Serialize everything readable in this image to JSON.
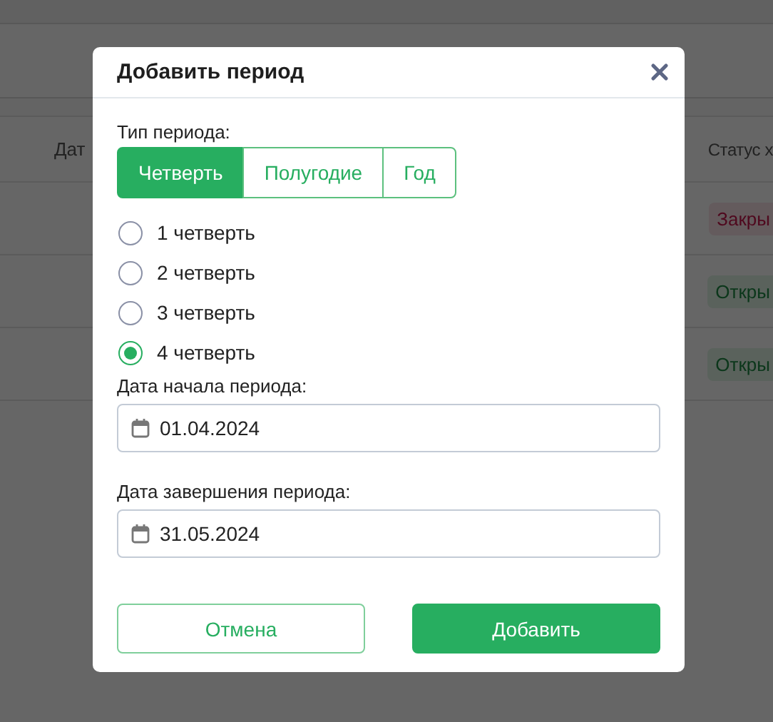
{
  "background": {
    "table": {
      "columns": [
        {
          "label": "Дат"
        },
        {
          "label": "Статус х"
        }
      ],
      "rows": [
        {
          "status": "Закры",
          "kind": "closed"
        },
        {
          "status": "Откры",
          "kind": "open"
        },
        {
          "status": "Откры",
          "kind": "open"
        }
      ]
    }
  },
  "dialog": {
    "title": "Добавить период",
    "period_type": {
      "label": "Тип периода:",
      "options": [
        {
          "label": "Четверть",
          "selected": true
        },
        {
          "label": "Полугодие",
          "selected": false
        },
        {
          "label": "Год",
          "selected": false
        }
      ]
    },
    "quarters": [
      {
        "label": "1 четверть",
        "selected": false
      },
      {
        "label": "2 четверть",
        "selected": false
      },
      {
        "label": "3 четверть",
        "selected": false
      },
      {
        "label": "4 четверть",
        "selected": true
      }
    ],
    "start_date": {
      "label": "Дата начала периода:",
      "value": "01.04.2024"
    },
    "end_date": {
      "label": "Дата завершения периода:",
      "value": "31.05.2024"
    },
    "buttons": [
      {
        "label": "Отмена",
        "kind": "secondary"
      },
      {
        "label": "Добавить",
        "kind": "primary"
      }
    ]
  }
}
